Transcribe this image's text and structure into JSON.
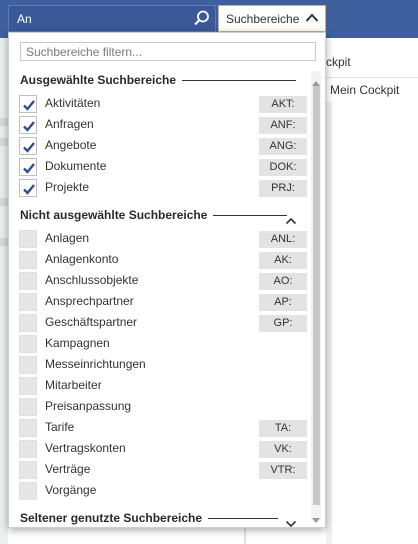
{
  "search": {
    "value": "An"
  },
  "scope_button": {
    "label": "Suchbereiche"
  },
  "right_panel": {
    "tab_active": "Cockpit",
    "tab_active_shown": "ckpit",
    "tab_item": "Mein Cockpit"
  },
  "dropdown": {
    "filter_placeholder": "Suchbereiche filtern...",
    "selected_title": "Ausgewählte Suchbereiche",
    "unselected_title": "Nicht ausgewählte Suchbereiche",
    "rare_title": "Seltener genutzte Suchbereiche",
    "selected": [
      {
        "label": "Aktivitäten",
        "code": "AKT:"
      },
      {
        "label": "Anfragen",
        "code": "ANF:"
      },
      {
        "label": "Angebote",
        "code": "ANG:"
      },
      {
        "label": "Dokumente",
        "code": "DOK:"
      },
      {
        "label": "Projekte",
        "code": "PRJ:"
      }
    ],
    "unselected": [
      {
        "label": "Anlagen",
        "code": "ANL:"
      },
      {
        "label": "Anlagenkonto",
        "code": "AK:"
      },
      {
        "label": "Anschlussobjekte",
        "code": "AO:"
      },
      {
        "label": "Ansprechpartner",
        "code": "AP:"
      },
      {
        "label": "Geschäftspartner",
        "code": "GP:"
      },
      {
        "label": "Kampagnen",
        "code": ""
      },
      {
        "label": "Messeinrichtungen",
        "code": ""
      },
      {
        "label": "Mitarbeiter",
        "code": ""
      },
      {
        "label": "Preisanpassung",
        "code": ""
      },
      {
        "label": "Tarife",
        "code": "TA:"
      },
      {
        "label": "Vertragskonten",
        "code": "VK:"
      },
      {
        "label": "Verträge",
        "code": "VTR:"
      },
      {
        "label": "Vorgänge",
        "code": ""
      }
    ]
  },
  "colors": {
    "topbar": "#3f5f9e",
    "check": "#2f4d8f",
    "accent_border": "#c8b47a"
  }
}
